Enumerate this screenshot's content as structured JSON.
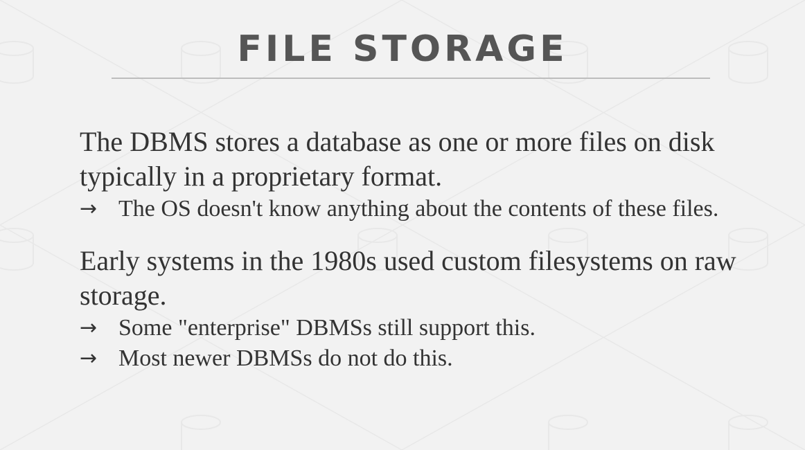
{
  "slide": {
    "title": "FILE STORAGE",
    "bullets": [
      {
        "text": "The DBMS stores a database as one or more files on disk typically in a proprietary format.",
        "sub": [
          {
            "arrow": "→",
            "text": "The OS doesn't know anything about the contents of these files."
          }
        ]
      },
      {
        "text": "Early systems in the 1980s used custom filesystems on raw storage.",
        "sub": [
          {
            "arrow": "→",
            "text": "Some \"enterprise\" DBMSs still support this."
          },
          {
            "arrow": "→",
            "text": "Most newer DBMSs do not do this."
          }
        ]
      }
    ]
  },
  "colors": {
    "background": "#f2f2f2",
    "title": "#555555",
    "text": "#333333",
    "rule": "#bdbdbd"
  }
}
